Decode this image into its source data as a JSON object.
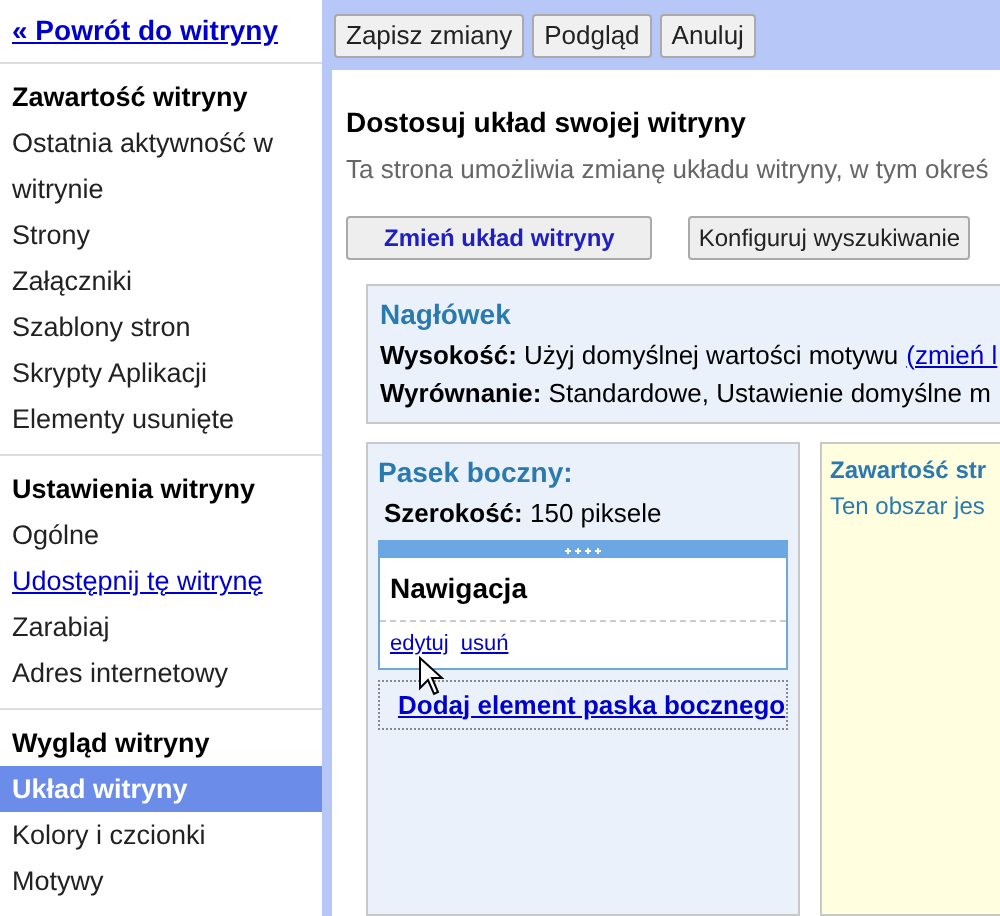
{
  "back_link": "« Powrót do witryny",
  "sidebar": [
    {
      "heading": "Zawartość witryny",
      "items": [
        {
          "label": "Ostatnia aktywność w witrynie",
          "kind": "item",
          "selected": false
        },
        {
          "label": "Strony",
          "kind": "item",
          "selected": false
        },
        {
          "label": "Załączniki",
          "kind": "item",
          "selected": false
        },
        {
          "label": "Szablony stron",
          "kind": "item",
          "selected": false
        },
        {
          "label": "Skrypty Aplikacji",
          "kind": "item",
          "selected": false
        },
        {
          "label": "Elementy usunięte",
          "kind": "item",
          "selected": false
        }
      ]
    },
    {
      "heading": "Ustawienia witryny",
      "items": [
        {
          "label": "Ogólne",
          "kind": "item",
          "selected": false
        },
        {
          "label": "Udostępnij tę witrynę",
          "kind": "link",
          "selected": false
        },
        {
          "label": "Zarabiaj",
          "kind": "item",
          "selected": false
        },
        {
          "label": "Adres internetowy",
          "kind": "item",
          "selected": false
        }
      ]
    },
    {
      "heading": "Wygląd witryny",
      "items": [
        {
          "label": "Układ witryny",
          "kind": "item",
          "selected": true
        },
        {
          "label": "Kolory i czcionki",
          "kind": "item",
          "selected": false
        },
        {
          "label": "Motywy",
          "kind": "item",
          "selected": false
        }
      ]
    }
  ],
  "toolbar": [
    "Zapisz zmiany",
    "Podgląd",
    "Anuluj"
  ],
  "title": "Dostosuj układ swojej witryny",
  "description": "Ta strona umożliwia zmianę układu witryny, w tym okreś",
  "actions": [
    {
      "label": "Zmień układ witryny",
      "kind": "primary"
    },
    {
      "label": "Konfiguruj wyszukiwanie",
      "kind": "normal"
    }
  ],
  "header_box": {
    "title": "Nagłówek",
    "lines": [
      {
        "label": "Wysokość:",
        "value": "Użyj domyślnej wartości motywu",
        "link": "(zmień l"
      },
      {
        "label": "Wyrównanie:",
        "value": "Standardowe, Ustawienie domyślne m"
      }
    ]
  },
  "sidebar_panel": {
    "title": "Pasek boczny:",
    "width_label": "Szerokość:",
    "width_value": "150 piksele",
    "gadget": {
      "title": "Nawigacja",
      "links": [
        "edytuj",
        "usuń"
      ]
    },
    "add": "Dodaj element paska bocznego"
  },
  "content_panel": {
    "title": "Zawartość str",
    "text": "Ten obszar jes"
  }
}
